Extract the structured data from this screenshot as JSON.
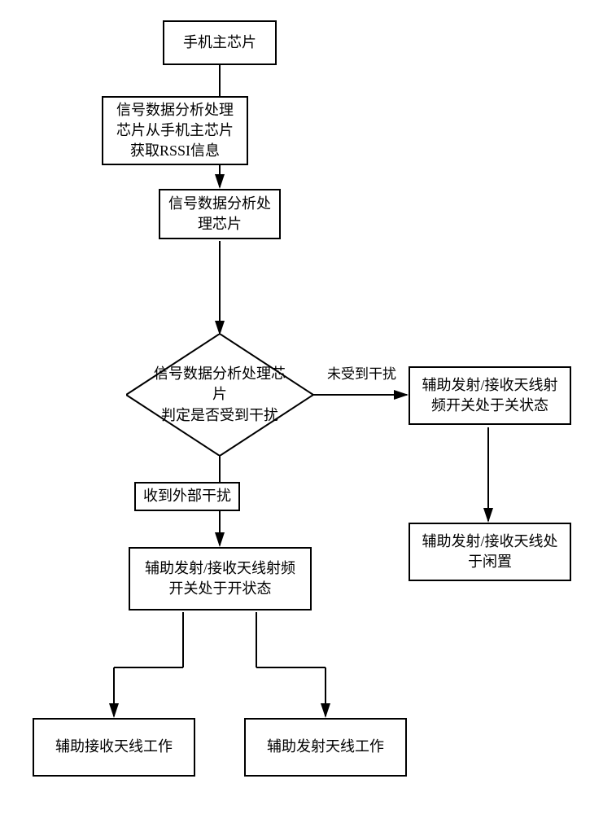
{
  "nodes": {
    "main_chip": "手机主芯片",
    "rssi_label": "信号数据分析处理\n芯片从手机主芯片\n获取RSSI信息",
    "signal_chip": "信号数据分析处\n理芯片",
    "decision": "信号数据分析处理芯片\n判定是否受到干扰",
    "no_interference_label": "未受到干扰",
    "switch_off": "辅助发射/接收天线射\n频开关处于关状态",
    "antenna_idle": "辅助发射/接收天线处\n于闲置",
    "interference_label": "收到外部干扰",
    "switch_on": "辅助发射/接收天线射频\n开关处于开状态",
    "rx_work": "辅助接收天线工作",
    "tx_work": "辅助发射天线工作"
  }
}
